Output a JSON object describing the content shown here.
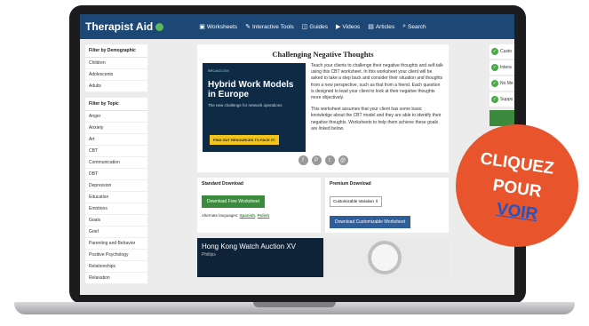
{
  "nav": {
    "logo": "Therapist Aid",
    "links": [
      {
        "label": "Worksheets",
        "icon": "worksheet-icon"
      },
      {
        "label": "Interactive Tools",
        "icon": "tools-icon"
      },
      {
        "label": "Guides",
        "icon": "guides-icon"
      },
      {
        "label": "Videos",
        "icon": "video-icon"
      },
      {
        "label": "Articles",
        "icon": "articles-icon"
      },
      {
        "label": "Search",
        "icon": "search-icon"
      }
    ]
  },
  "sidebar": {
    "demographic": {
      "title": "Filter by Demographic",
      "items": [
        "Children",
        "Adolescents",
        "Adults"
      ]
    },
    "topic": {
      "title": "Filter by Topic",
      "items": [
        "Anger",
        "Anxiety",
        "Art",
        "CBT",
        "Communication",
        "DBT",
        "Depression",
        "Education",
        "Emotions",
        "Goals",
        "Grief",
        "Parenting and Behavior",
        "Positive Psychology",
        "Relationships",
        "Relaxation"
      ]
    }
  },
  "main": {
    "title": "Challenging Negative Thoughts",
    "paragraph1": "Teach your clients to challenge their negative thoughts and self-talk using this CBT worksheet. In this worksheet your client will be asked to take a step back and consider their situation and thoughts from a new perspective, such as that from a friend. Each question is designed to lead your client to look at their negative thoughts more objectively.",
    "paragraph2": "This worksheet assumes that your client has some basic knowledge about the CBT model and they are able to identify their negative thoughts. Worksheets to help them achieve these goals are linked below.",
    "ad": {
      "brand": "BROADCOM",
      "headline": "Hybrid Work Models in Europe",
      "sub": "The new challenge for network operations",
      "cta": "FIND OUT RESOURCES TO FACE IT!"
    },
    "social_icons": [
      "facebook-icon",
      "pinterest-icon",
      "twitter-icon",
      "email-icon"
    ]
  },
  "download": {
    "standard": {
      "title": "Standard Download",
      "button": "Download Free Worksheet",
      "alt_label": "Alternate languages:",
      "alt_langs": [
        "Spanish",
        "Polish"
      ]
    },
    "premium": {
      "title": "Premium Download",
      "select": "Customizable Variation",
      "button": "Download Customizable Worksheet"
    }
  },
  "banner": {
    "title": "Hong Kong Watch Auction XV",
    "sub": "Phillips"
  },
  "right": {
    "checks": [
      "Custo",
      "Intera",
      "No Me",
      "Suppo"
    ]
  },
  "badge": {
    "line1": "CLIQUEZ",
    "line2": "POUR",
    "line3": "VOIR",
    "color": "#e8542c"
  }
}
